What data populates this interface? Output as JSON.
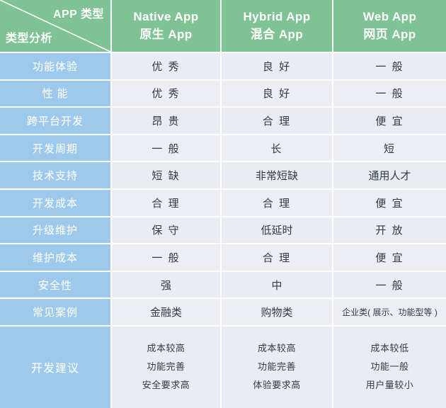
{
  "table": {
    "corner": {
      "top_label": "APP 类型",
      "bottom_label": "类型分析"
    },
    "columns": [
      {
        "en": "Native App",
        "cn": "原生 App"
      },
      {
        "en": "Hybrid App",
        "cn": "混合 App"
      },
      {
        "en": "Web App",
        "cn": "网页 App"
      }
    ],
    "rows": [
      {
        "label": "功能体验",
        "values": [
          "优 秀",
          "良 好",
          "一 般"
        ]
      },
      {
        "label": "性 能",
        "values": [
          "优 秀",
          "良 好",
          "一 般"
        ]
      },
      {
        "label": "跨平台开发",
        "values": [
          "昂 贵",
          "合 理",
          "便 宜"
        ]
      },
      {
        "label": "开发周期",
        "values": [
          "一 般",
          "长",
          "短"
        ]
      },
      {
        "label": "技术支持",
        "values": [
          "短 缺",
          "非常短缺",
          "通用人才"
        ]
      },
      {
        "label": "开发成本",
        "values": [
          "合 理",
          "合 理",
          "便 宜"
        ]
      },
      {
        "label": "升级维护",
        "values": [
          "保 守",
          "低延时",
          "开 放"
        ]
      },
      {
        "label": "维护成本",
        "values": [
          "一 般",
          "合 理",
          "便 宜"
        ]
      },
      {
        "label": "安全性",
        "values": [
          "强",
          "中",
          "一 般"
        ]
      },
      {
        "label": "常见案例",
        "values": [
          "金融类",
          "购物类",
          "企业类( 展示、功能型等 )"
        ]
      }
    ],
    "final_row": {
      "label": "开发建议",
      "values": [
        [
          "成本较高",
          "功能完善",
          "安全要求高"
        ],
        [
          "成本较高",
          "功能完善",
          "体验要求高"
        ],
        [
          "成本较低",
          "功能一般",
          "用户量较小"
        ]
      ]
    },
    "colors": {
      "header_green": "#7fc294",
      "label_blue": "#9cc9ec",
      "cell_grey": "#e9ecf3",
      "text_dark": "#333a42",
      "white": "#ffffff"
    }
  }
}
